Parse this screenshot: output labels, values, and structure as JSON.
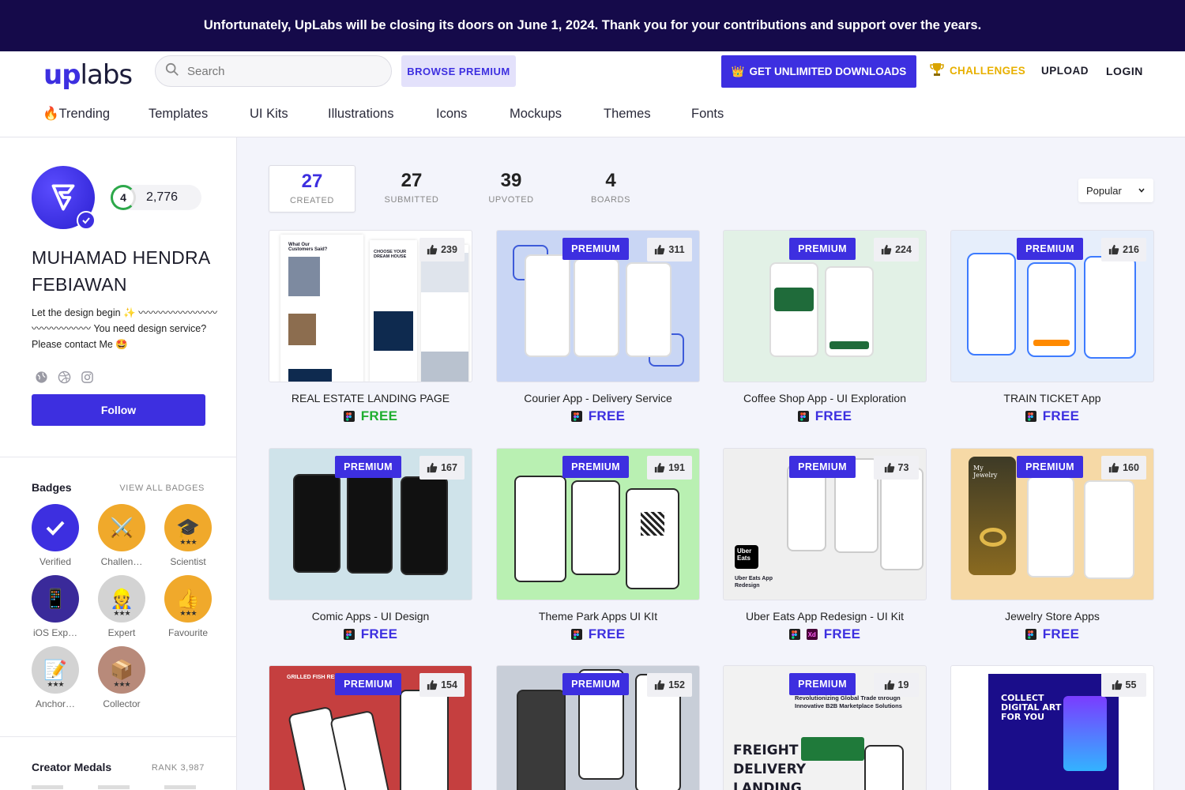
{
  "banner": {
    "text": "Unfortunately, UpLabs will be closing its doors on June 1, 2024. Thank you for your contributions and support over the years."
  },
  "header": {
    "logo_up": "up",
    "logo_labs": "labs",
    "search_placeholder": "Search",
    "browse_premium": "BROWSE PREMIUM",
    "unlimited": "GET UNLIMITED DOWNLOADS",
    "challenges": "CHALLENGES",
    "upload": "UPLOAD",
    "login": "LOGIN",
    "nav": [
      "🔥Trending",
      "Templates",
      "UI Kits",
      "Illustrations",
      "Icons",
      "Mockups",
      "Themes",
      "Fonts"
    ]
  },
  "profile": {
    "level": "4",
    "points": "2,776",
    "name": "MUHAMAD HENDRA FEBIAWAN",
    "bio": "Let the design begin ✨ 〰〰〰〰〰〰〰〰〰〰〰〰〰〰 You need design service? Please contact Me 🤩",
    "follow": "Follow"
  },
  "badges": {
    "title": "Badges",
    "link": "VIEW ALL BADGES",
    "items": [
      {
        "label": "Verified",
        "icon": "check-icon",
        "color": "#3d2fe0",
        "stars": ""
      },
      {
        "label": "Challen…",
        "icon": "crossed-swords-icon",
        "color": "#f0a92b",
        "stars": ""
      },
      {
        "label": "Scientist",
        "icon": "graduation-cap-icon",
        "color": "#f0a92b",
        "stars": "★★★"
      },
      {
        "label": "iOS Exp…",
        "icon": "phone-icon",
        "color": "#3a2a9a",
        "stars": ""
      },
      {
        "label": "Expert",
        "icon": "expert-icon",
        "color": "#cfcfcf",
        "stars": "★★★"
      },
      {
        "label": "Favourite",
        "icon": "thumbs-up-icon",
        "color": "#f0a92b",
        "stars": "★★★"
      },
      {
        "label": "Anchor…",
        "icon": "memo-icon",
        "color": "#cfcfcf",
        "stars": "★★★"
      },
      {
        "label": "Collector",
        "icon": "box-icon",
        "color": "#b88a7a",
        "stars": "★★★"
      }
    ]
  },
  "medals": {
    "title": "Creator Medals",
    "rank": "RANK 3,987"
  },
  "stats": [
    {
      "num": "27",
      "label": "CREATED"
    },
    {
      "num": "27",
      "label": "SUBMITTED"
    },
    {
      "num": "39",
      "label": "UPVOTED"
    },
    {
      "num": "4",
      "label": "BOARDS"
    }
  ],
  "sort": {
    "value": "Popular"
  },
  "cards": [
    {
      "title": "REAL ESTATE LANDING PAGE",
      "likes": "239",
      "premium": "",
      "price": "FREE",
      "xd": false,
      "bg": "#ffffff"
    },
    {
      "title": "Courier App - Delivery Service",
      "likes": "311",
      "premium": "PREMIUM",
      "price": "FREE",
      "xd": false,
      "bg": "#c9d6f4"
    },
    {
      "title": "Coffee Shop App - UI Exploration",
      "likes": "224",
      "premium": "PREMIUM",
      "price": "FREE",
      "xd": false,
      "bg": "#e2f1e6"
    },
    {
      "title": "TRAIN TICKET App",
      "likes": "216",
      "premium": "PREMIUM",
      "price": "FREE",
      "xd": false,
      "bg": "#e6eefb"
    },
    {
      "title": "Comic Apps - UI Design",
      "likes": "167",
      "premium": "PREMIUM",
      "price": "FREE",
      "xd": false,
      "bg": "#cfe3ea"
    },
    {
      "title": "Theme Park Apps UI KIt",
      "likes": "191",
      "premium": "PREMIUM",
      "price": "FREE",
      "xd": false,
      "bg": "#b9f0b2"
    },
    {
      "title": "Uber Eats App Redesign - UI Kit",
      "likes": "73",
      "premium": "PREMIUM",
      "price": "FREE",
      "xd": true,
      "bg": "#efefef"
    },
    {
      "title": "Jewelry Store Apps",
      "likes": "160",
      "premium": "PREMIUM",
      "price": "FREE",
      "xd": false,
      "bg": "#f6d9a6"
    },
    {
      "title": "",
      "likes": "154",
      "premium": "PREMIUM",
      "price": "",
      "xd": false,
      "bg": "#c53f3f"
    },
    {
      "title": "",
      "likes": "152",
      "premium": "PREMIUM",
      "price": "",
      "xd": false,
      "bg": "#c8ced8"
    },
    {
      "title": "",
      "likes": "19",
      "premium": "PREMIUM",
      "price": "",
      "xd": false,
      "bg": "#f2f2f2"
    },
    {
      "title": "",
      "likes": "55",
      "premium": "",
      "price": "",
      "xd": false,
      "bg": "#ffffff"
    }
  ],
  "thumb_text": {
    "real_estate_heading": "What Our Customers Said?",
    "real_estate_dream": "CHOOSE YOUR DREAM HOUSE",
    "uber_logo": "Uber Eats",
    "uber_caption": "Uber Eats App Redesign",
    "jewelry_title": "My Jewelry",
    "fish_restaurant": "GRILLED FISH RESTAURANT",
    "freight": "FREIGHT DELIVERY LANDING PAGE",
    "freight_sub": "Revolutionizing Global Trade through Innovative B2B Marketplace Solutions",
    "nft": "COLLECT DIGITAL ART FOR YOU"
  }
}
